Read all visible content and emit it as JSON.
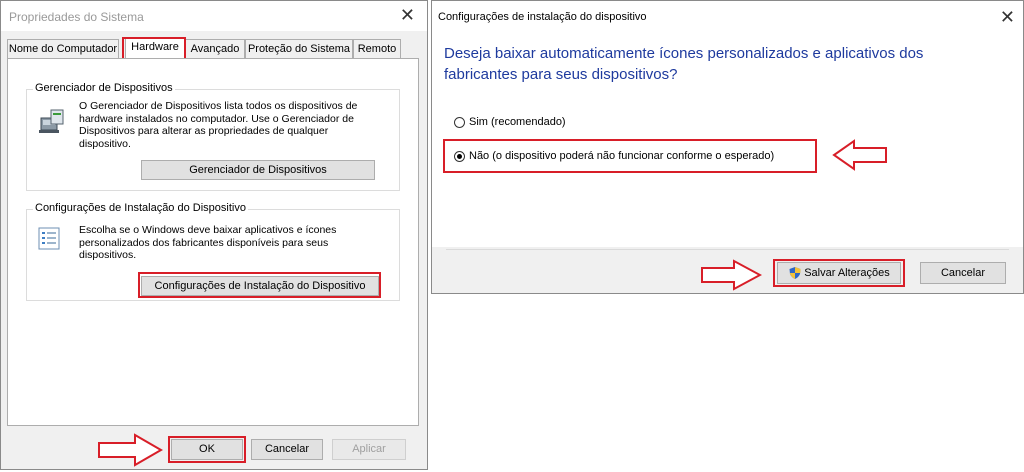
{
  "left_dialog": {
    "title": "Propriedades do Sistema",
    "close_glyph": "✕",
    "tabs": [
      {
        "label": "Nome do Computador"
      },
      {
        "label": "Hardware"
      },
      {
        "label": "Avançado"
      },
      {
        "label": "Proteção do Sistema"
      },
      {
        "label": "Remoto"
      }
    ],
    "device_manager": {
      "group_label": "Gerenciador de Dispositivos",
      "icon": "device-manager-icon",
      "description": "O Gerenciador de Dispositivos lista todos os dispositivos de hardware instalados no computador. Use o Gerenciador de Dispositivos para alterar as propriedades de qualquer dispositivo.",
      "button_label": "Gerenciador de Dispositivos"
    },
    "device_install": {
      "group_label": "Configurações de Instalação do Dispositivo",
      "icon": "settings-list-icon",
      "description": "Escolha se o Windows deve baixar aplicativos e ícones personalizados dos fabricantes disponíveis para seus dispositivos.",
      "button_label": "Configurações de Instalação do Dispositivo"
    },
    "footer": {
      "ok_label": "OK",
      "cancel_label": "Cancelar",
      "apply_label": "Aplicar"
    }
  },
  "right_dialog": {
    "title": "Configurações de instalação do dispositivo",
    "close_glyph": "✕",
    "question": "Deseja baixar automaticamente ícones personalizados e aplicativos dos fabricantes para seus dispositivos?",
    "options": [
      {
        "label": "Sim (recomendado)",
        "checked": false
      },
      {
        "label": "Não (o dispositivo poderá não funcionar conforme o esperado)",
        "checked": true
      }
    ],
    "save_label": "Salvar Alterações",
    "save_icon": "uac-shield-icon",
    "cancel_label": "Cancelar"
  },
  "colors": {
    "highlight_red": "#d81e28",
    "question_blue": "#1e3a9e"
  }
}
